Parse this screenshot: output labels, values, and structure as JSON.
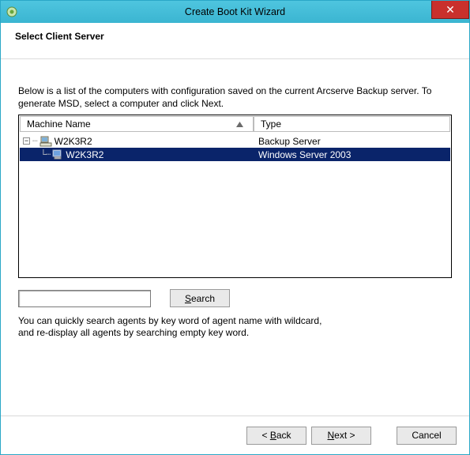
{
  "window": {
    "title": "Create Boot Kit Wizard",
    "close_glyph": "✕"
  },
  "page": {
    "heading": "Select Client Server",
    "intro": "Below is a list of the computers with configuration saved on the current Arcserve Backup server. To generate MSD, select a computer and click Next."
  },
  "columns": {
    "name": "Machine Name",
    "type": "Type"
  },
  "tree": {
    "expander_glyph": "−",
    "root": {
      "name": "W2K3R2",
      "type": "Backup Server"
    },
    "child": {
      "name": "W2K3R2",
      "type": "Windows Server 2003"
    }
  },
  "search": {
    "value": "",
    "button_prefix": "",
    "button_key": "S",
    "button_suffix": "earch",
    "hint_l1": "You can quickly search agents by key word of agent name with wildcard,",
    "hint_l2": "and re-display all agents by searching empty key word."
  },
  "footer": {
    "back_prefix": "< ",
    "back_key": "B",
    "back_suffix": "ack",
    "next_key": "N",
    "next_suffix": "ext >",
    "cancel": "Cancel"
  }
}
